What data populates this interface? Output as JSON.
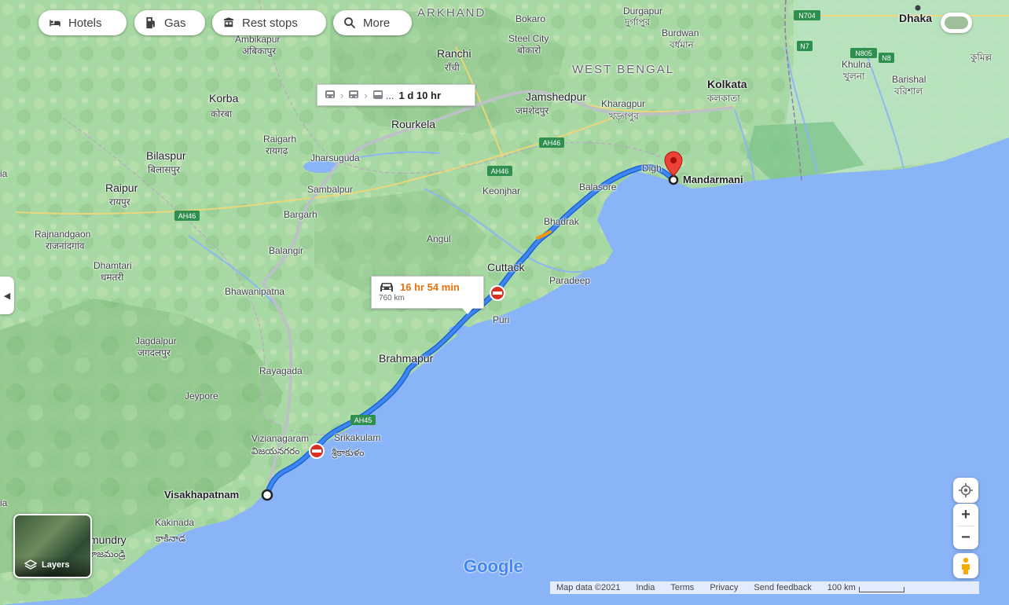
{
  "toolbar": {
    "hotels_label": "Hotels",
    "gas_label": "Gas",
    "rest_stops_label": "Rest stops",
    "more_label": "More"
  },
  "routes": {
    "driving": {
      "duration": "16 hr 54 min",
      "distance": "760 km"
    },
    "transit": {
      "duration": "1 d 10 hr",
      "ellipsis": "..."
    }
  },
  "endpoints": {
    "origin": "Visakhapatnam",
    "destination": "Mandarmani"
  },
  "places": {
    "jharkhand": "ARKHAND",
    "west_bengal": "WEST BENGAL",
    "dhaka": "Dhaka",
    "durgapur": "Durgapur",
    "durgapur_bn": "দুর্গাপুর",
    "bokaro": "Bokaro",
    "steel_city": "Steel City",
    "bokaro_hi": "बोकारो",
    "ranchi": "Ranchi",
    "ranchi_hi": "राँची",
    "burdwan": "Burdwan",
    "burdwan_bn": "বর্ধমান",
    "ambikapur": "Ambikapur",
    "ambikapur_hi": "अंबिकापुर",
    "korba": "Korba",
    "korba_hi": "कोरबा",
    "jamshedpur": "Jamshedpur",
    "jamshedpur_hi": "जमशेदपुर",
    "kharagpur": "Kharagpur",
    "kharagpur_bn": "খড়্গপুর",
    "kolkata": "Kolkata",
    "kolkata_bn": "কলকাতা",
    "khulna": "Khulna",
    "khulna_bn": "খুলনা",
    "barishal": "Barishal",
    "barishal_bn": "বরিশাল",
    "cumilla_bn": "কুমিল্ল",
    "rourkela": "Rourkela",
    "raigarh": "Raigarh",
    "raigarh_hi": "रायगढ़",
    "jharsuguda": "Jharsuguda",
    "bilaspur": "Bilaspur",
    "bilaspur_hi": "बिलासपुर",
    "raipur": "Raipur",
    "raipur_hi": "रायपुर",
    "sambalpur": "Sambalpur",
    "keonjhar": "Keonjhar",
    "balasore": "Balasore",
    "digha": "Digh",
    "bargarh": "Bargarh",
    "bhadrak": "Bhadrak",
    "rajnandgaon": "Rajnandgaon",
    "rajnandgaon_hi": "राजनांदगांव",
    "balangir": "Balangir",
    "angul": "Angul",
    "dhamtari": "Dhamtari",
    "dhamtari_hi": "धमतरी",
    "cuttack": "Cuttack",
    "paradeep": "Paradeep",
    "bhawanipatna": "Bhawanipatna",
    "puri": "Puri",
    "brahmapur": "Brahmapur",
    "jagdalpur": "Jagdalpur",
    "jagdalpur_hi": "जगदलपुर",
    "rayagada": "Rayagada",
    "jeypore": "Jeypore",
    "vizianagaram": "Vizianagaram",
    "vizianagaram_te": "విజయనగరం",
    "srikakulam": "Srikakulam",
    "srikakulam_te": "శ్రీకాకుళం",
    "kakinada": "Kakinada",
    "kakinada_te": "కాకినాడ",
    "rajahmundry": "mundry",
    "rajahmundry_te": "రాజమండ్రి",
    "ia": "ia",
    "ia2": "ia"
  },
  "shields": {
    "ah46_a": "AH46",
    "ah46_b": "AH46",
    "ah46_c": "AH46",
    "ah45": "AH45",
    "n704": "N704",
    "n7": "N7",
    "n805": "N805",
    "n8": "N8"
  },
  "layers": {
    "label": "Layers"
  },
  "logo": "Google",
  "footer": {
    "map_data": "Map data ©2021",
    "india": "India",
    "terms": "Terms",
    "privacy": "Privacy",
    "feedback": "Send feedback",
    "scale": "100 km"
  },
  "controls": {
    "zoom_in": "+",
    "zoom_out": "−"
  },
  "colors": {
    "water": "#8ab4f8",
    "land": "#a8dab5",
    "route": "#4285f4",
    "alt_route": "#bcc1c6",
    "traffic": "#f29900",
    "closure": "#d93025",
    "duration": "#e8710a"
  }
}
